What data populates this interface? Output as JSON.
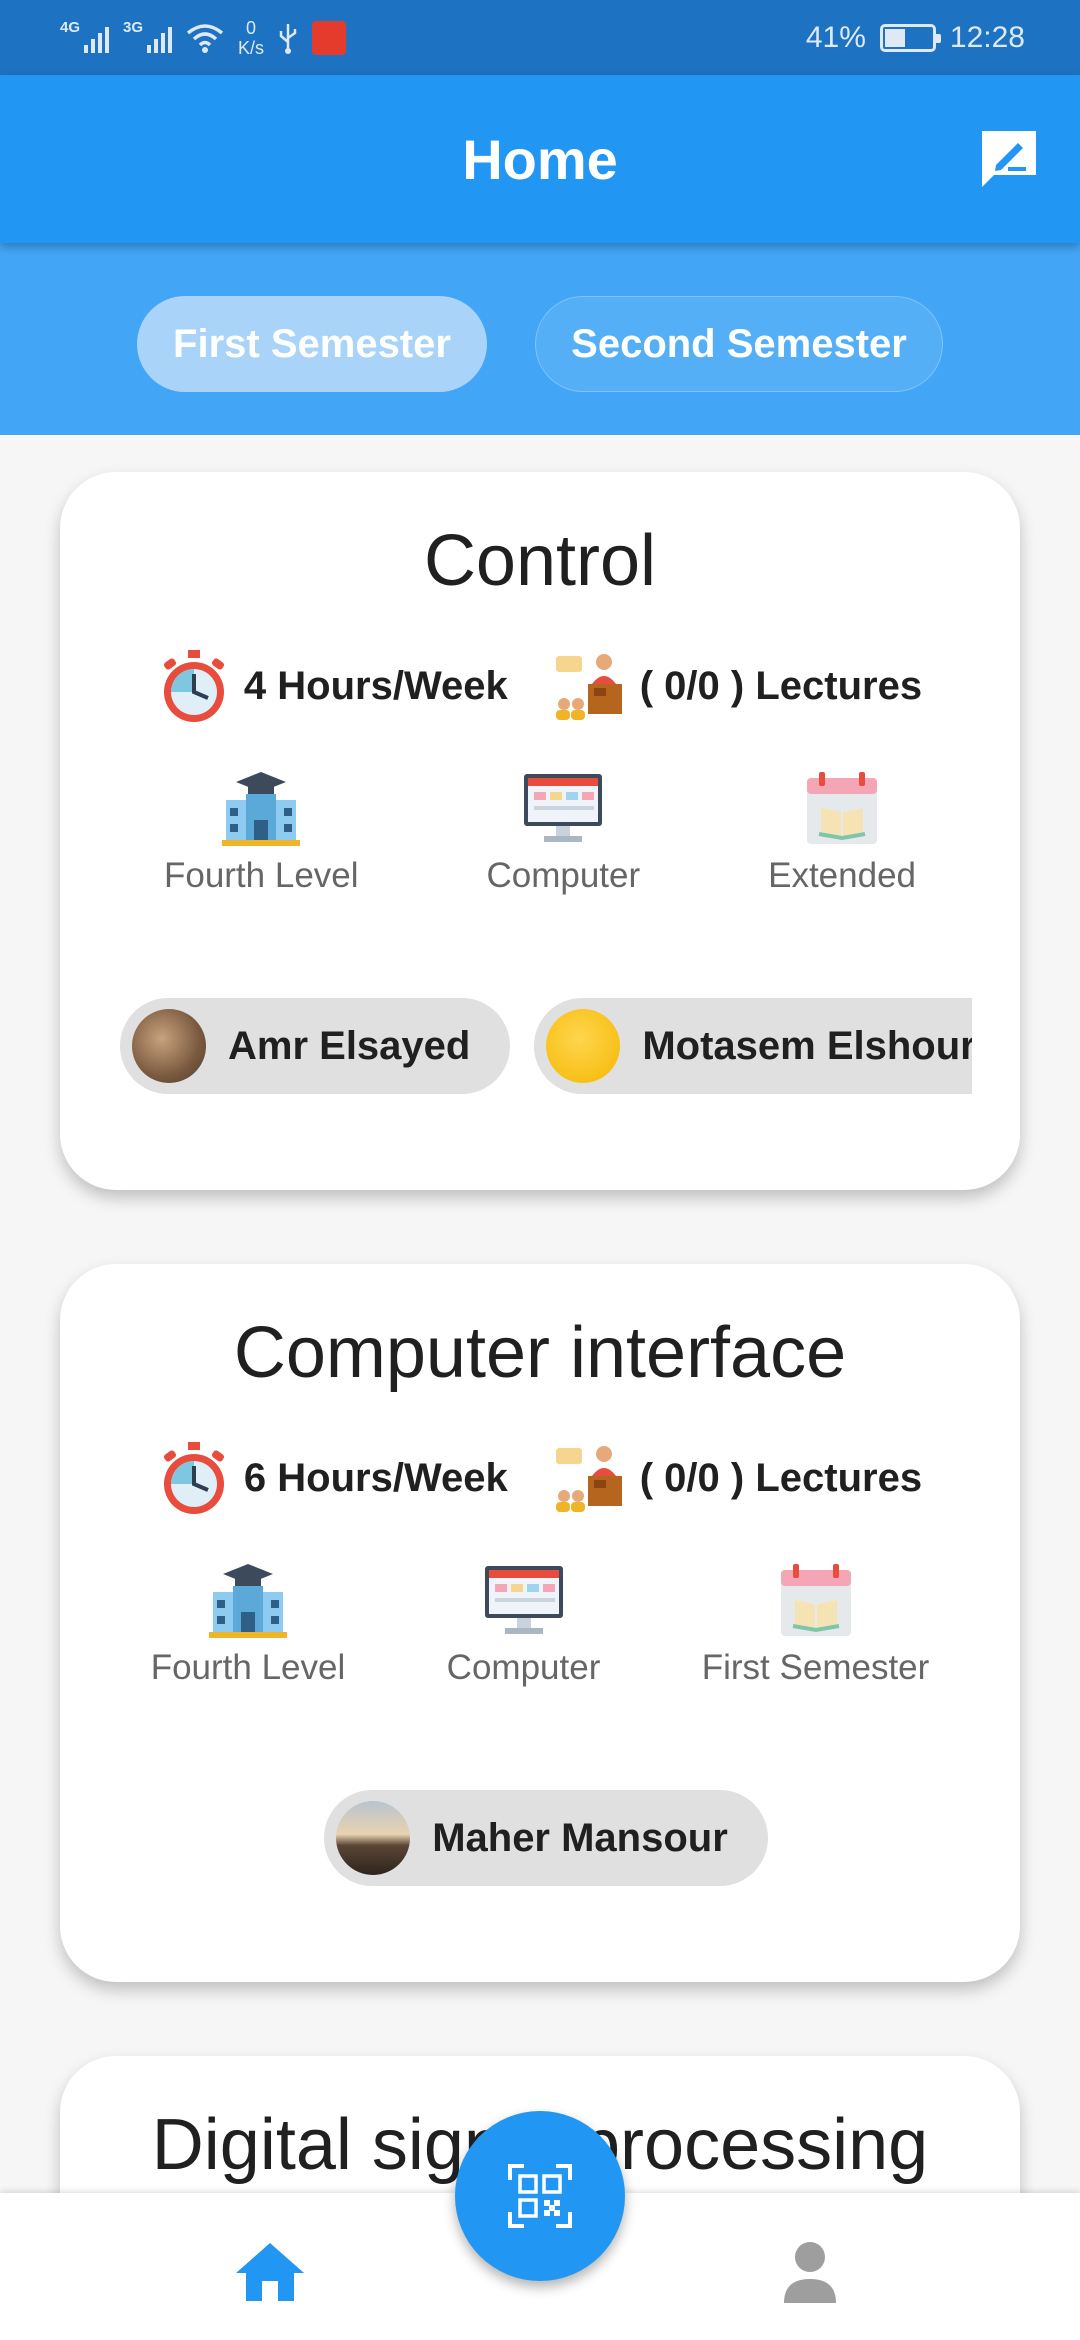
{
  "status_bar": {
    "network_1": "4G",
    "network_2": "3G",
    "speed_value": "0",
    "speed_unit": "K/s",
    "battery": "41%",
    "battery_level": 0.41,
    "time": "12:28"
  },
  "app_bar": {
    "title": "Home"
  },
  "tabs": [
    {
      "label": "First Semester",
      "active": true
    },
    {
      "label": "Second Semester",
      "active": false
    }
  ],
  "courses": [
    {
      "title": "Control",
      "hours": "4 Hours/Week",
      "lectures": "( 0/0 ) Lectures",
      "level": "Fourth Level",
      "department": "Computer",
      "term": "Extended",
      "instructors": [
        "Amr Elsayed",
        "Motasem Elshourbagy"
      ]
    },
    {
      "title": "Computer interface",
      "hours": "6 Hours/Week",
      "lectures": "( 0/0 ) Lectures",
      "level": "Fourth Level",
      "department": "Computer",
      "term": "First Semester",
      "instructors": [
        "Maher Mansour"
      ]
    },
    {
      "title": "Digital signal processing"
    }
  ],
  "colors": {
    "status_bar": "#1d72c2",
    "app_bar": "#2196f3",
    "tabs_band": "#42a5f5",
    "fab": "#2196f3",
    "nav_active": "#2196f3",
    "nav_inactive": "#9e9e9e"
  },
  "icons": {
    "app_bar_action": "chat-edit-icon",
    "hours": "stopwatch-icon",
    "lectures": "lecturer-icon",
    "level": "university-building-icon",
    "department": "computer-monitor-icon",
    "term": "calendar-book-icon",
    "fab": "qr-scan-icon",
    "nav_home": "home-icon",
    "nav_profile": "person-icon"
  }
}
